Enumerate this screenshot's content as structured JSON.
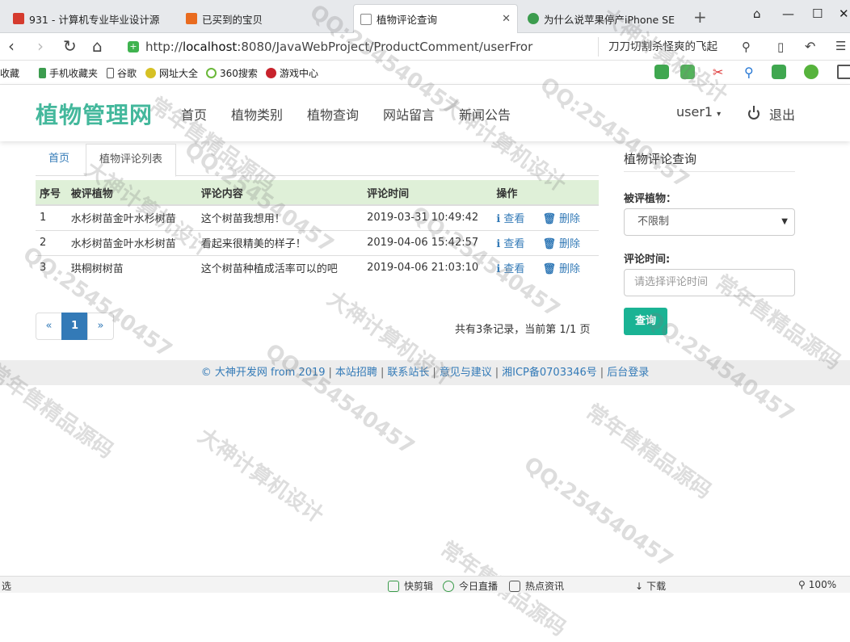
{
  "browser": {
    "tabs": [
      {
        "title": "931 - 计算机专业毕业设计源",
        "fav_color": "#d53b2e"
      },
      {
        "title": "已买到的宝贝",
        "fav_color": "#e96b1f"
      },
      {
        "title": "植物评论查询",
        "fav_color": "#ffffff"
      },
      {
        "title": "为什么说苹果停产iPhone SE",
        "fav_color": "#3c9c4e"
      }
    ],
    "url_prefix": "http://",
    "url_host": "localhost",
    "url_rest": ":8080/JavaWebProject/ProductComment/userFror",
    "search_text": "刀刀切割杀怪爽的飞起",
    "bookmarks": [
      "收藏",
      "手机收藏夹",
      "谷歌",
      "网址大全",
      "360搜索",
      "游戏中心"
    ]
  },
  "site": {
    "brand": "植物管理网",
    "menu": [
      "首页",
      "植物类别",
      "植物查询",
      "网站留言",
      "新闻公告"
    ],
    "user": "user1",
    "logout": "退出"
  },
  "page_tabs": {
    "home": "首页",
    "current": "植物评论列表"
  },
  "table": {
    "headers": [
      "序号",
      "被评植物",
      "评论内容",
      "评论时间",
      "操作"
    ],
    "rows": [
      {
        "no": "1",
        "plant": "水杉树苗金叶水杉树苗",
        "content": "这个树苗我想用！",
        "time": "2019-03-31 10:49:42"
      },
      {
        "no": "2",
        "plant": "水杉树苗金叶水杉树苗",
        "content": "看起来很精美的样子！",
        "time": "2019-04-06 15:42:57"
      },
      {
        "no": "3",
        "plant": "珙桐树树苗",
        "content": "这个树苗种植成活率可以的吧",
        "time": "2019-04-06 21:03:10"
      }
    ],
    "view_label": "查看",
    "delete_label": "删除"
  },
  "pagination": {
    "prev": "«",
    "current": "1",
    "next": "»",
    "info": "共有3条记录，当前第 1/1 页"
  },
  "sidebar": {
    "title": "植物评论查询",
    "plant_label": "被评植物：",
    "plant_value": "不限制",
    "time_label": "评论时间:",
    "time_placeholder": "请选择评论时间",
    "query_button": "查询"
  },
  "footer": {
    "links": [
      "© 大神开发网 from 2019",
      "本站招聘",
      "联系站长",
      "意见与建议",
      "湘ICP备0703346号",
      "后台登录"
    ]
  },
  "statusbar": {
    "left": "选",
    "items": [
      "快剪辑",
      "今日直播",
      "热点资讯",
      "下载",
      "100%"
    ]
  },
  "watermarks": [
    "QQ:254540457",
    "大神计算机设计",
    "常年售精品源码"
  ],
  "colors": {
    "brand": "#44b89c",
    "link": "#337ab7",
    "thead_bg": "#dff0d8",
    "query_btn": "#1ab394"
  }
}
